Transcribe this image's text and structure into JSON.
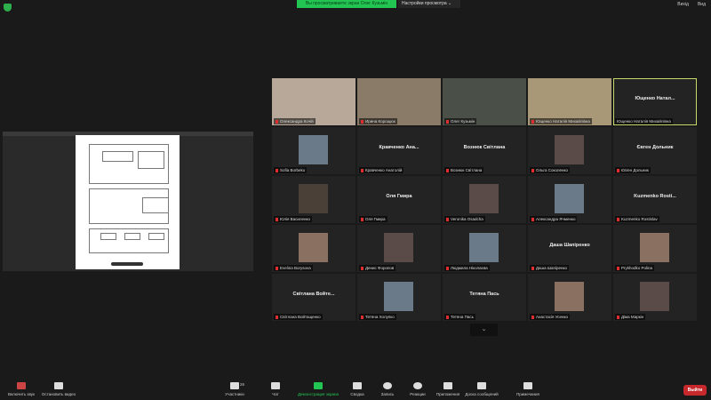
{
  "top": {
    "banner": "Вы просматриваете экран Олег Кузьмін",
    "view_options": "Настройки просмотра ⌄",
    "right": [
      "Вихід",
      "Вид"
    ]
  },
  "tiles": [
    {
      "name": "Олександра Кочій",
      "video": true
    },
    {
      "name": "Ирина Корощюк",
      "video": true
    },
    {
      "name": "Олег Кузьмін",
      "video": true
    },
    {
      "name": "Ющенко Наталія Михайлівна",
      "video": true
    },
    {
      "name": "Ющенко Наталія Михайлівна",
      "big": "Ющенко Натал...",
      "active": true
    },
    {
      "name": "Sofia Borbeko",
      "avatar": true
    },
    {
      "name": "Кравченко Анатолій",
      "big": "Кравченко Ана..."
    },
    {
      "name": "Вознюк Світлана",
      "big": "Вознюк Світлана"
    },
    {
      "name": "Ольга Соколенко",
      "avatar": true
    },
    {
      "name": "Євген Дольник",
      "big": "Євген Дольник"
    },
    {
      "name": "Юлія Василенко",
      "avatar": true
    },
    {
      "name": "Оля Гмира",
      "big": "Оля Гмира"
    },
    {
      "name": "Veronika Osadcha",
      "avatar": true
    },
    {
      "name": "Александра Ячменко",
      "avatar": true
    },
    {
      "name": "Kuzmenko Rostislav",
      "big": "Kuzmenko Rosti..."
    },
    {
      "name": "Evelina Borysova",
      "avatar": true
    },
    {
      "name": "Денис Форопов",
      "avatar": true
    },
    {
      "name": "Людмила Ніколаєва",
      "avatar": true
    },
    {
      "name": "Даша Шапіренко",
      "big": "Даша Шапіренко"
    },
    {
      "name": "Prykhodko Polina",
      "avatar": true
    },
    {
      "name": "Світлана Войтащенко",
      "big": "Світлана Войте..."
    },
    {
      "name": "Тетяна Холупко",
      "avatar": true
    },
    {
      "name": "Тетяна Пась",
      "big": "Тетяна Пась"
    },
    {
      "name": "Анастасія Усенко",
      "avatar": true
    },
    {
      "name": "Діма Маркін",
      "avatar": true
    }
  ],
  "more_icon": "chevron-down-icon",
  "toolbar": {
    "unmute": "Включить звук",
    "video": "Остановить видео",
    "participants": "Участники",
    "participants_count": "26",
    "chat": "Чат",
    "share": "Демонстрация экрана",
    "summary": "Сводка",
    "record": "Запись",
    "reactions": "Реакции",
    "apps": "Приложения",
    "whiteboard": "Доска сообщений",
    "notes": "Примечания",
    "leave": "Выйти"
  },
  "colors": {
    "share_green": "#23c552",
    "leave_red": "#c6282b",
    "active_border": "#c8d86a"
  }
}
